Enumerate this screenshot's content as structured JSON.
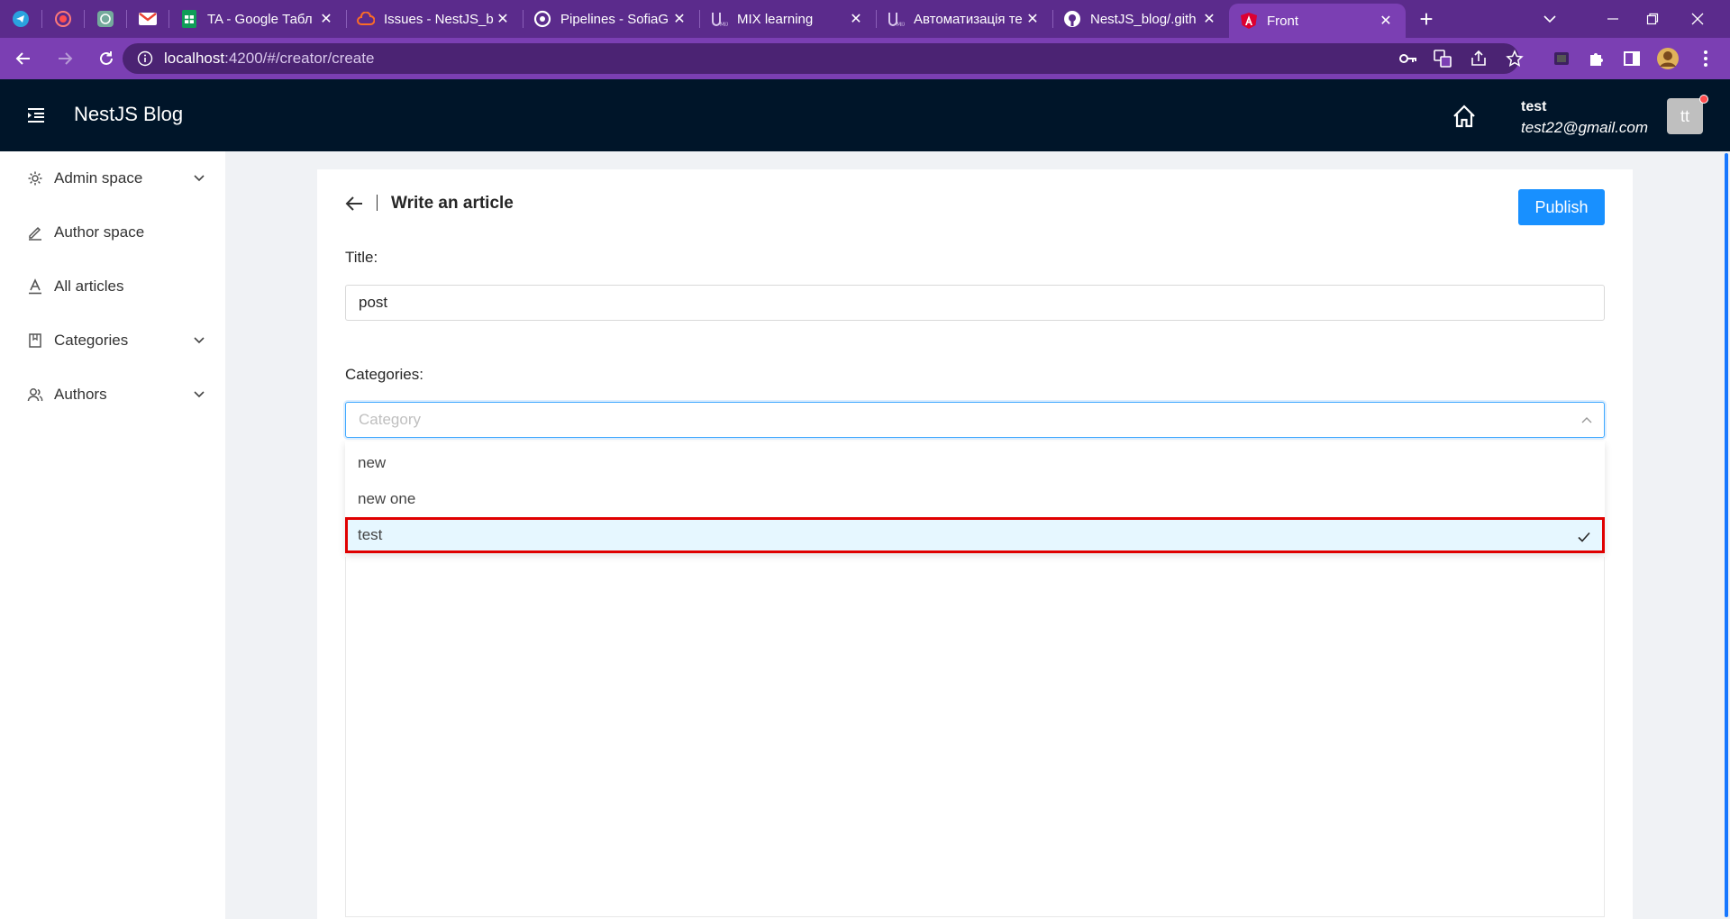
{
  "browser": {
    "tabs": [
      {
        "label": "TA - Google Табл",
        "icon": "sheets-icon"
      },
      {
        "label": "Issues - NestJS_bl",
        "icon": "cloud-icon"
      },
      {
        "label": "Pipelines - SofiaG",
        "icon": "pipeline-icon"
      },
      {
        "label": "MIX learning",
        "icon": "umix-icon"
      },
      {
        "label": "Автоматизація те",
        "icon": "umix-icon"
      },
      {
        "label": "NestJS_blog/.gith",
        "icon": "github-icon"
      },
      {
        "label": "Front",
        "icon": "angular-icon",
        "active": true
      }
    ],
    "url_host": "localhost",
    "url_path": ":4200/#/creator/create",
    "theme_color": "#7b3fb3"
  },
  "app": {
    "brand": "NestJS Blog",
    "user_name": "test",
    "user_email": "test22@gmail.com",
    "avatar_initials": "tt",
    "header_color": "#001529"
  },
  "sidebar": {
    "items": [
      {
        "label": "Admin space",
        "icon": "gear-icon",
        "expandable": true
      },
      {
        "label": "Author space",
        "icon": "edit-icon",
        "expandable": false
      },
      {
        "label": "All articles",
        "icon": "font-icon",
        "expandable": false
      },
      {
        "label": "Categories",
        "icon": "book-icon",
        "expandable": true
      },
      {
        "label": "Authors",
        "icon": "team-icon",
        "expandable": true
      }
    ]
  },
  "editor": {
    "page_title": "Write an article",
    "publish_label": "Publish",
    "title_label": "Title:",
    "title_value": "post",
    "categories_label": "Categories:",
    "category_placeholder": "Category",
    "options": [
      {
        "label": "new",
        "selected": false
      },
      {
        "label": "new one",
        "selected": false
      },
      {
        "label": "test",
        "selected": true
      }
    ],
    "accent_color": "#1890ff"
  }
}
